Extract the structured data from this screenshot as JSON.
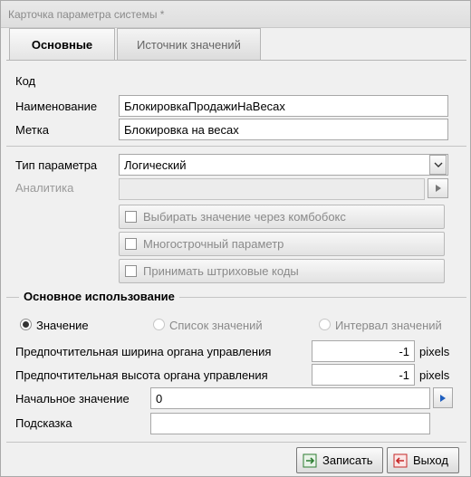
{
  "window": {
    "title": "Карточка параметра системы *"
  },
  "tabs": [
    {
      "label": "Основные"
    },
    {
      "label": "Источник значений"
    }
  ],
  "fields": {
    "code": {
      "label": "Код",
      "value": ""
    },
    "name": {
      "label": "Наименование",
      "value": "БлокировкаПродажиНаВесах"
    },
    "tag": {
      "label": "Метка",
      "value": "Блокировка на весах"
    },
    "param_type": {
      "label": "Тип параметра",
      "value": "Логический"
    },
    "analytics": {
      "label": "Аналитика",
      "value": ""
    }
  },
  "checkboxes": [
    {
      "label": "Выбирать значение через комбобокс",
      "checked": false
    },
    {
      "label": "Многострочный параметр",
      "checked": false
    },
    {
      "label": "Принимать штриховые коды",
      "checked": false
    }
  ],
  "usage": {
    "title": "Основное использование",
    "options": [
      {
        "label": "Значение",
        "selected": true
      },
      {
        "label": "Список значений",
        "selected": false
      },
      {
        "label": "Интервал значений",
        "selected": false
      }
    ],
    "pref_width": {
      "label": "Предпочтительная ширина органа управления",
      "value": "-1",
      "unit": "pixels"
    },
    "pref_height": {
      "label": "Предпочтительная высота органа управления",
      "value": "-1",
      "unit": "pixels"
    },
    "initial": {
      "label": "Начальное значение",
      "value": "0"
    },
    "hint": {
      "label": "Подсказка",
      "value": ""
    }
  },
  "buttons": {
    "save": "Записать",
    "exit": "Выход"
  },
  "icons": {
    "save": "save-icon",
    "exit": "exit-icon",
    "dropdown": "chevron-down-icon",
    "play": "play-arrow-icon"
  }
}
